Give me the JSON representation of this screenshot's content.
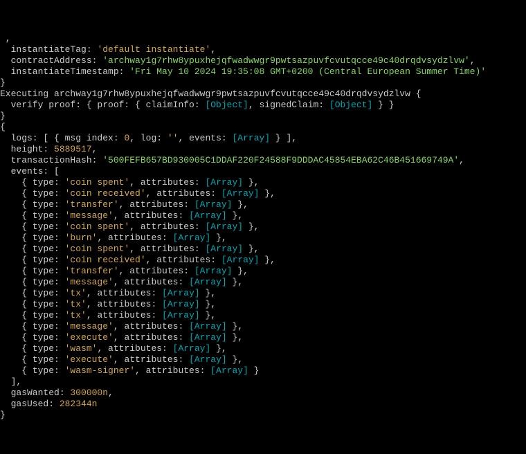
{
  "l0": {
    "instantiateTag": "'default instantiate'"
  },
  "l1": {
    "contractAddress": "'archway1g7rhw8ypuxhejqfwadwwgr9pwtsazpuvfcvutqcce49c40drqdvsydzlvw'"
  },
  "l2": {
    "instantiateTimestamp": "'Fri May 10 2024 19:35:08 GMT+0200 (Central European Summer Time)'"
  },
  "exec": "Executing archway1g7rhw8ypuxhejqfwadwwgr9pwtsazpuvfcvutqcce49c40drqdvsydzlvw {",
  "obj1": "[Object]",
  "obj2": "[Object]",
  "msgindex": "0",
  "logstr": "''",
  "arrLog": "[Array]",
  "height": "5889517",
  "txhash": "'500FEFB657BD930005C1DDAF220F24588F9DDDAC45854EBA62C46B451669749A'",
  "events": [
    {
      "type": "'coin spent'"
    },
    {
      "type": "'coin received'"
    },
    {
      "type": "'transfer'"
    },
    {
      "type": "'message'"
    },
    {
      "type": "'coin spent'"
    },
    {
      "type": "'burn'"
    },
    {
      "type": "'coin spent'"
    },
    {
      "type": "'coin received'"
    },
    {
      "type": "'transfer'"
    },
    {
      "type": "'message'"
    },
    {
      "type": "'tx'"
    },
    {
      "type": "'tx'"
    },
    {
      "type": "'tx'"
    },
    {
      "type": "'message'"
    },
    {
      "type": "'execute'"
    },
    {
      "type": "'wasm'"
    },
    {
      "type": "'execute'"
    },
    {
      "type": "'wasm-signer'"
    }
  ],
  "arr": "[Array]",
  "gasWanted": "300000n",
  "gasUsed": "282344n"
}
